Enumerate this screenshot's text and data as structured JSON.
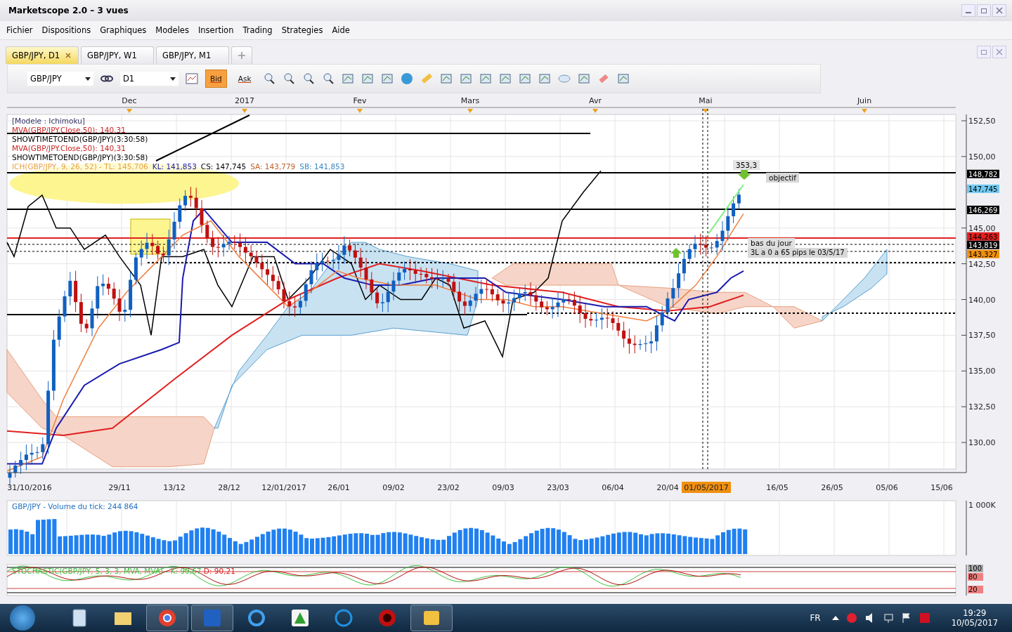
{
  "window": {
    "title": "Marketscope 2.0 – 3 vues"
  },
  "menu": [
    "Fichier",
    "Dispositions",
    "Graphiques",
    "Modeles",
    "Insertion",
    "Trading",
    "Strategies",
    "Aide"
  ],
  "tabs": [
    {
      "label": "GBP/JPY, D1",
      "selected": true
    },
    {
      "label": "GBP/JPY, W1",
      "selected": false
    },
    {
      "label": "GBP/JPY, M1",
      "selected": false
    }
  ],
  "toolbar": {
    "symbol": "GBP/JPY",
    "period": "D1",
    "price_buttons": [
      {
        "label": "Bid",
        "selected": true
      },
      {
        "label": "Ask",
        "selected": false
      }
    ]
  },
  "chart": {
    "months": [
      "Dec",
      "2017",
      "Fev",
      "Mars",
      "Avr",
      "Mai",
      "Juin"
    ],
    "legend": [
      {
        "text": "[Modele : Ichimoku]",
        "color": "#333366"
      },
      {
        "text": "MVA(GBP/JPY.Close,50): 140,31",
        "color": "#cc2222"
      },
      {
        "text": "SHOWTIMETOEND(GBP/JPY)(3:30:58)",
        "color": "#000000"
      },
      {
        "text": "MVA(GBP/JPY.Close,50): 140,31",
        "color": "#cc2222"
      },
      {
        "text": "SHOWTIMETOEND(GBP/JPY)(3:30:58)",
        "color": "#000000"
      }
    ],
    "ichimoku_legend": [
      {
        "text": "ICH(GBP/JPY, 9, 26, 52) -  TL: 145,706",
        "color": "#e8a040"
      },
      {
        "text": "KL: 141,853",
        "color": "#1a1aa0"
      },
      {
        "text": "CS: 147,745",
        "color": "#000000"
      },
      {
        "text": "SA: 143,779",
        "color": "#c0602a"
      },
      {
        "text": "SB: 141,853",
        "color": "#3a88c0"
      }
    ],
    "price_ticks": [
      "152,50",
      "150,00",
      "145,00",
      "142,50",
      "140,00",
      "137,50",
      "135,00",
      "132,50",
      "130,00"
    ],
    "price_labels": [
      {
        "text": "148,782",
        "color": "#000000"
      },
      {
        "text": "147,745",
        "color": "#70c8f0"
      },
      {
        "text": "146,269",
        "color": "#000000"
      },
      {
        "text": "144,263",
        "color": "#e02020"
      },
      {
        "text": "143,819",
        "color": "#000000"
      },
      {
        "text": "143,327",
        "color": "#f09010"
      }
    ],
    "annotations": [
      {
        "text": "353,3",
        "kind": "target"
      },
      {
        "text": "objectif",
        "kind": "note"
      },
      {
        "text": "bas du jour",
        "kind": "low"
      },
      {
        "text": "3L a 0 a 65 pips le 03/5/17",
        "kind": "signal"
      }
    ],
    "dates": [
      "31/10/2016",
      "29/11",
      "13/12",
      "28/12",
      "12/01/2017",
      "26/01",
      "09/02",
      "23/02",
      "09/03",
      "23/03",
      "06/04",
      "20/04",
      "16/05",
      "26/05",
      "05/06",
      "15/06"
    ],
    "cursor_date": "01/05/2017"
  },
  "volume": {
    "title": "GBP/JPY - Volume du tick: 244 864",
    "tick": "1 000K"
  },
  "stochastic": {
    "title": "STOCHASTIC(GBP/JPY, 5, 3, 3, MVA, MVA) -  K: 90,67",
    "d": "D: 90,21",
    "ticks": [
      "100",
      "80",
      "20"
    ]
  },
  "taskbar": {
    "language": "FR",
    "time": "19:29",
    "date": "10/05/2017"
  }
}
